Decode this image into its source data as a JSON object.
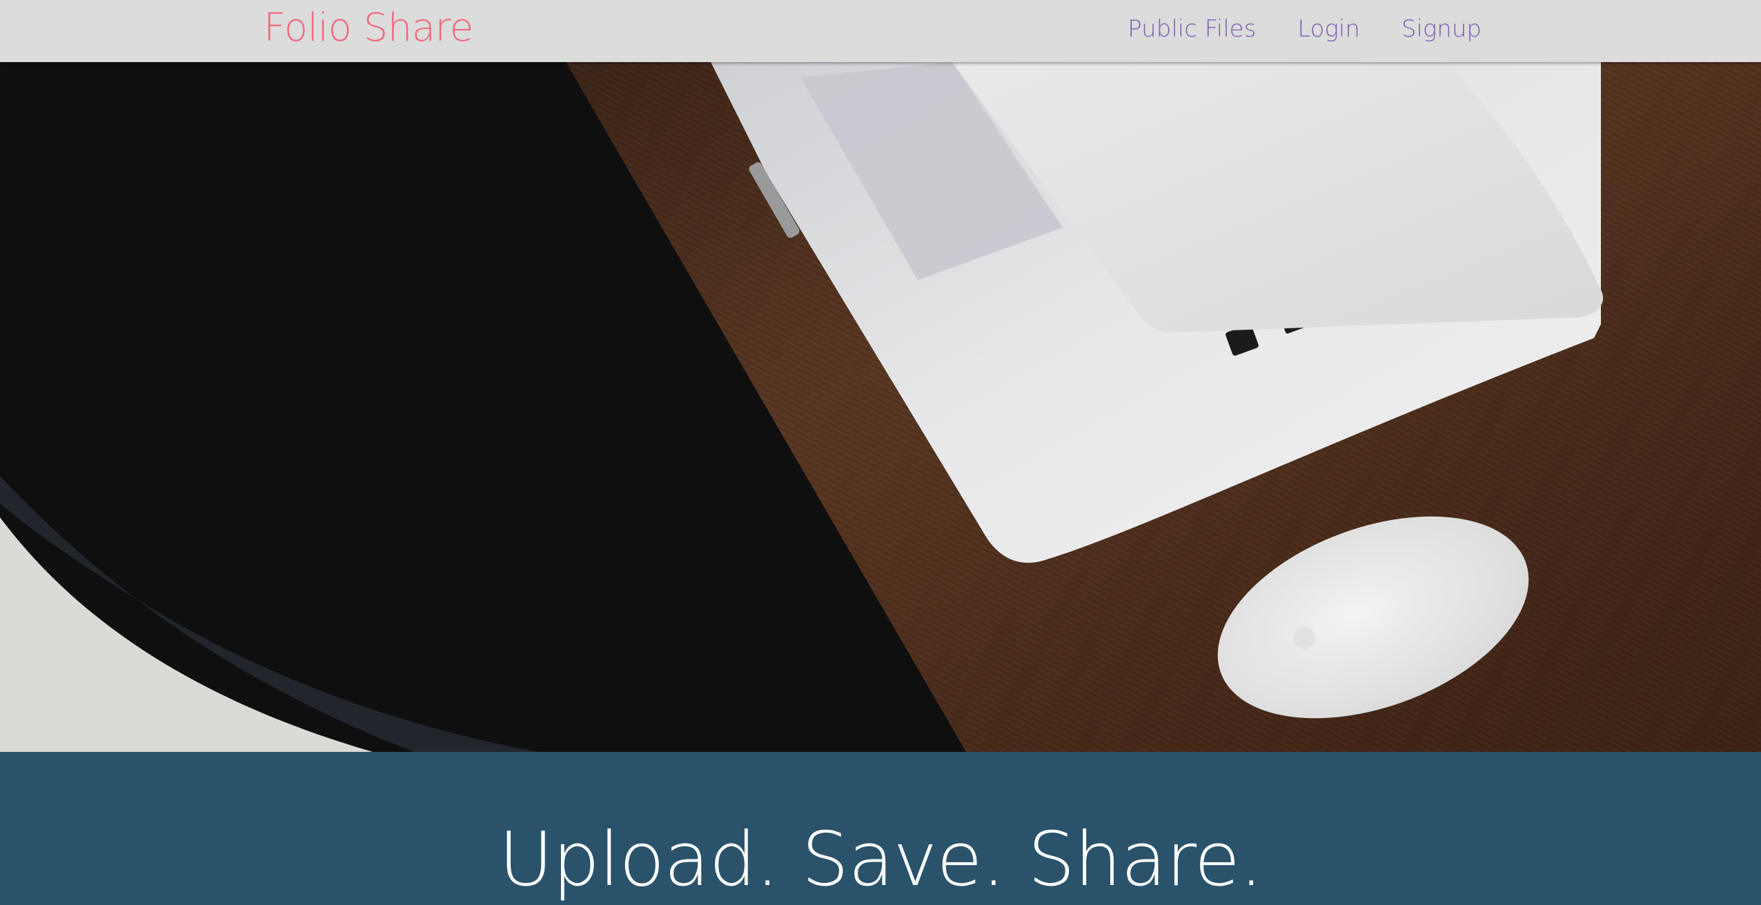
{
  "navbar": {
    "brand": "Folio Share",
    "links": [
      "Public Files",
      "Login",
      "Signup"
    ]
  },
  "hero": {
    "image": "laptop-and-mouse-on-wooden-desk"
  },
  "tagline": {
    "text": "Upload. Save. Share."
  },
  "colors": {
    "navbar_bg": "#dcdcdc",
    "brand": "#ef6b7e",
    "nav_link": "#7d5db0",
    "tagline_band": "#2a536b",
    "tagline_text": "#ffffff"
  }
}
